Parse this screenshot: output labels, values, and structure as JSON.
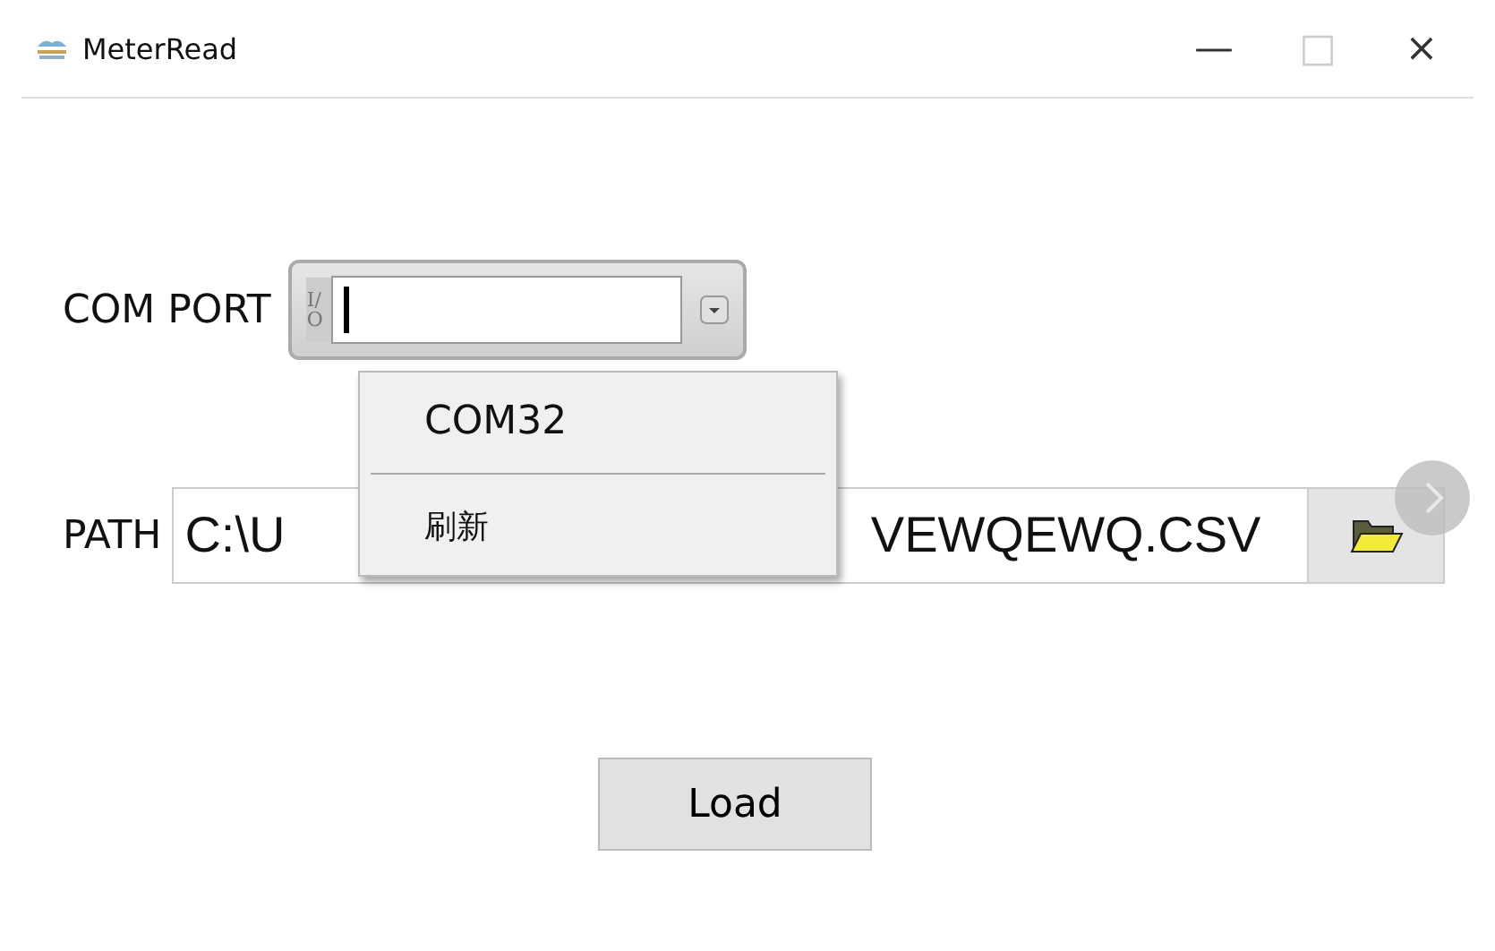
{
  "window": {
    "title": "MeterRead",
    "controls": [
      "—",
      "□",
      "×"
    ]
  },
  "com_port": {
    "label": "COM PORT",
    "io_badge": "I/O",
    "dropdown": {
      "expanded": true,
      "items": [
        {
          "label": "COM32",
          "kind": "option"
        },
        {
          "label": "刷新",
          "kind": "option"
        }
      ]
    }
  },
  "path": {
    "label": "PATH",
    "value_start": "C:\\U",
    "value_end": "VEWQEWQ.CSV"
  },
  "load_button": "Load"
}
